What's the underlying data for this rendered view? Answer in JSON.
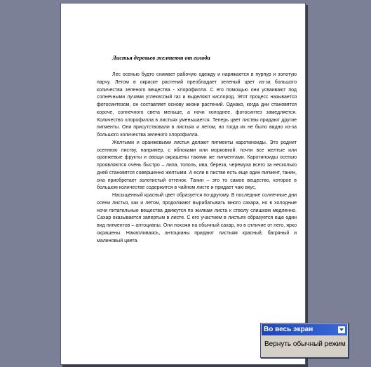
{
  "document": {
    "title": "Листья деревьев желтеют от голода",
    "paragraphs": [
      "Лес осенью будто снимает рабочую одежду и наряжается в пурпур и золотую парчу. Летом в окраске растений преобладает зеленый цвет из-за большого количества зеленого вещества - хлорофилла. С его помощью они усваивают под солнечными лучами углекислый газ и выделяют кислород. Этот процесс называется фотосинтезом, он составляет основу жизни растений. Однако, когда дни становятся короче, солнечного света меньше, а ночи холоднее, фотосинтез замедляется. Количество хлорофилла в листьях уменьшается. Теперь цвет листвы придают другие пигменты. Они присутствовали в листьях и летом, но тогда их не было видно из-за большого количества зеленого хлорофилла.",
      "Желтыми и оранжевыми листья делают пигменты каротиноиды. Это роднит осеннюю листву, например, с яблоками или морковкой: почти все желтые или оранжевые фрукты и овощи окрашены такими же пигментами. Каротиноиды осенью проявляются очень быстро – липа, тополь, ива, береза, черемуха всего за несколько дней становятся совершенно желтыми. А если в листве есть еще один пигмент, танин, она приобретает золотистый оттенок. Танин – это то самое вещество, которое в большом количестве содержится в чайном листе и придает чаю вкус.",
      "Насыщенный красный цвет образуется по-другому. В последние солнечные дни осени листья, как и летом, продолжают вырабатывать много сахара, но в холодные ночи питательные вещества движутся по жилкам листа к стволу слишком медленно. Сахар оказывается запертым в листе. С его участием в листьях образуется еще один вид пигментов – антоцианы. Они похожи на обычный сахар, но в отличие от него, ярко окрашены. Накапливаясь, антоцианы придают листьям красный, багряный и малиновый цвета."
    ]
  },
  "toolbar": {
    "title": "Во весь экран",
    "close_button_label": "Вернуть обычный режим"
  }
}
